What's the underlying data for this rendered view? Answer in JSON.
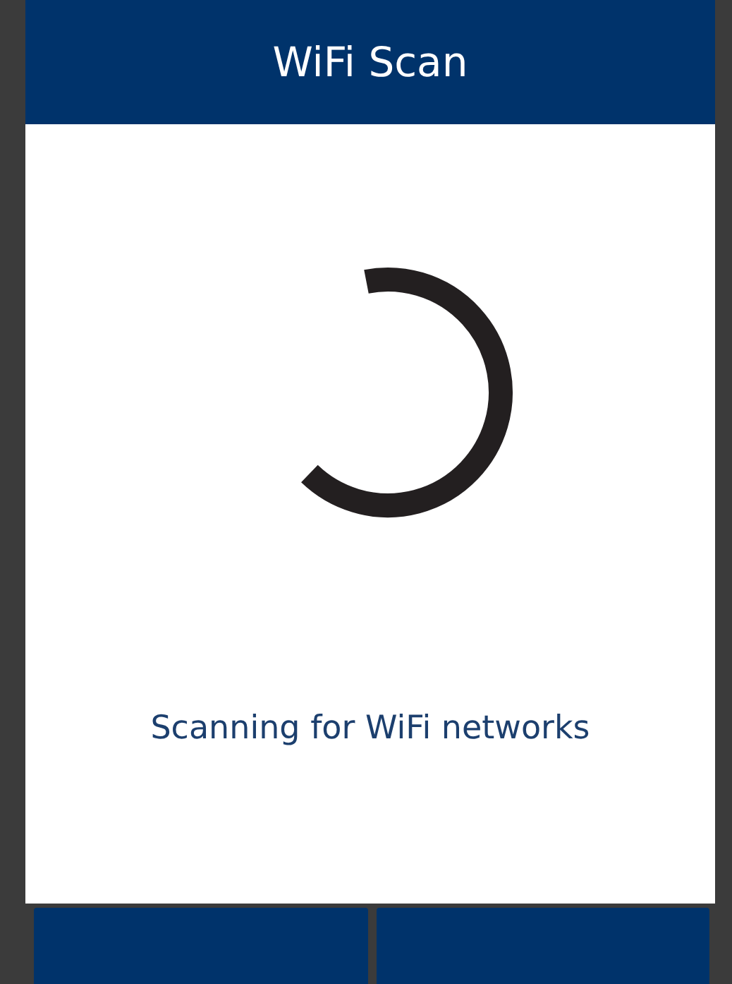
{
  "header": {
    "title": "WiFi Scan"
  },
  "status": {
    "message": "Scanning for WiFi networks"
  },
  "buttons": [
    {
      "kind": "soft-key"
    },
    {
      "kind": "soft-key"
    }
  ]
}
